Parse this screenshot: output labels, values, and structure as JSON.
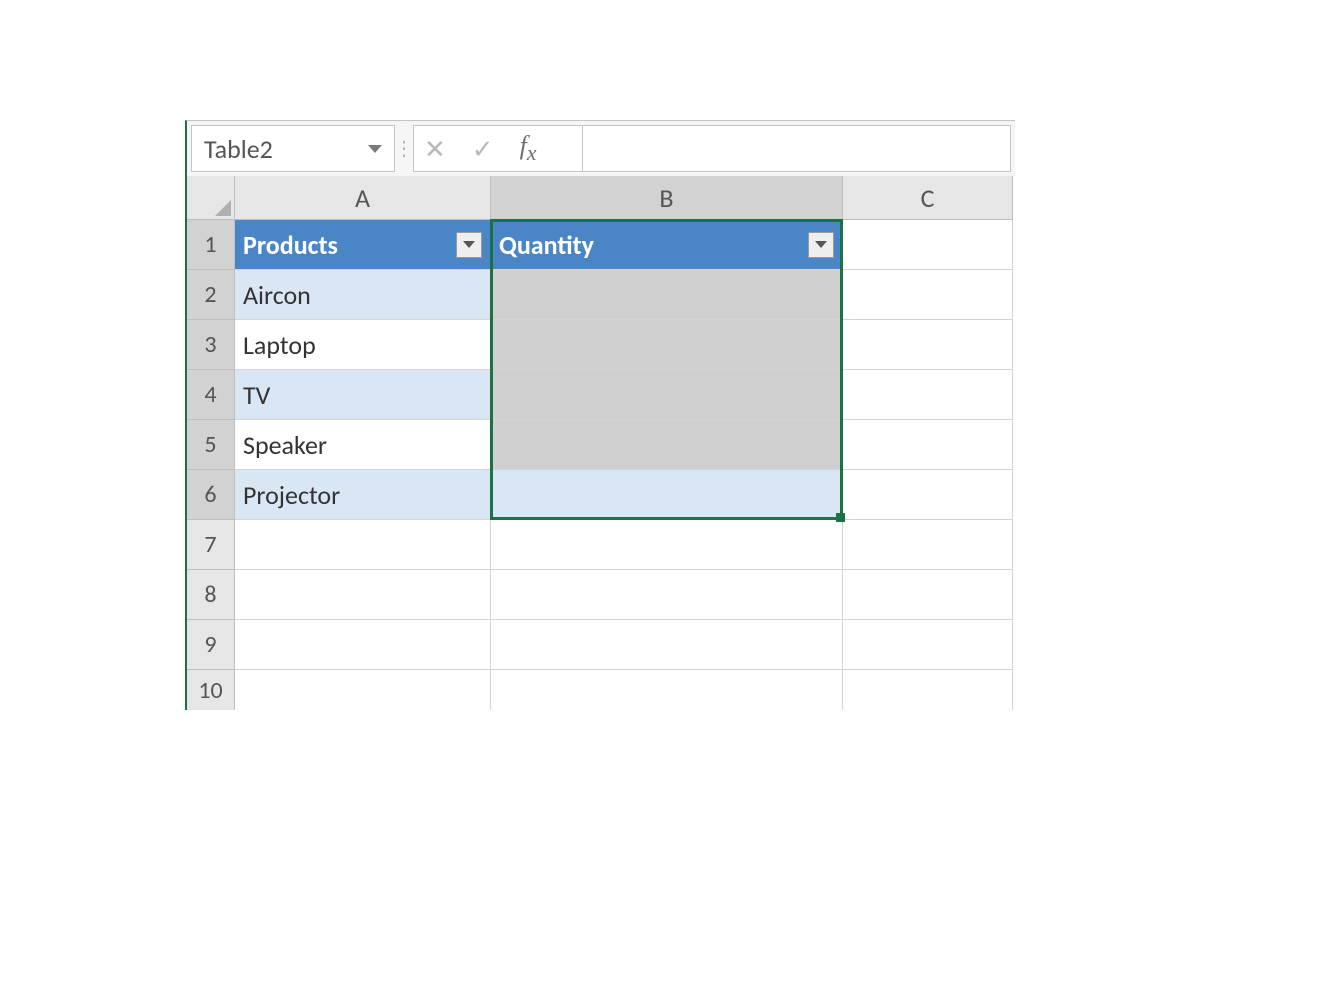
{
  "name_box": {
    "value": "Table2"
  },
  "formula_bar": {
    "value": ""
  },
  "columns": [
    "A",
    "B",
    "C"
  ],
  "row_numbers": [
    1,
    2,
    3,
    4,
    5,
    6,
    7,
    8,
    9,
    10
  ],
  "table": {
    "headers": {
      "colA": "Products",
      "colB": "Quantity"
    },
    "rows": [
      {
        "product": "Aircon",
        "quantity": ""
      },
      {
        "product": "Laptop",
        "quantity": ""
      },
      {
        "product": "TV",
        "quantity": ""
      },
      {
        "product": "Speaker",
        "quantity": ""
      },
      {
        "product": "Projector",
        "quantity": ""
      }
    ]
  },
  "selection": {
    "range": "B1:B6"
  }
}
